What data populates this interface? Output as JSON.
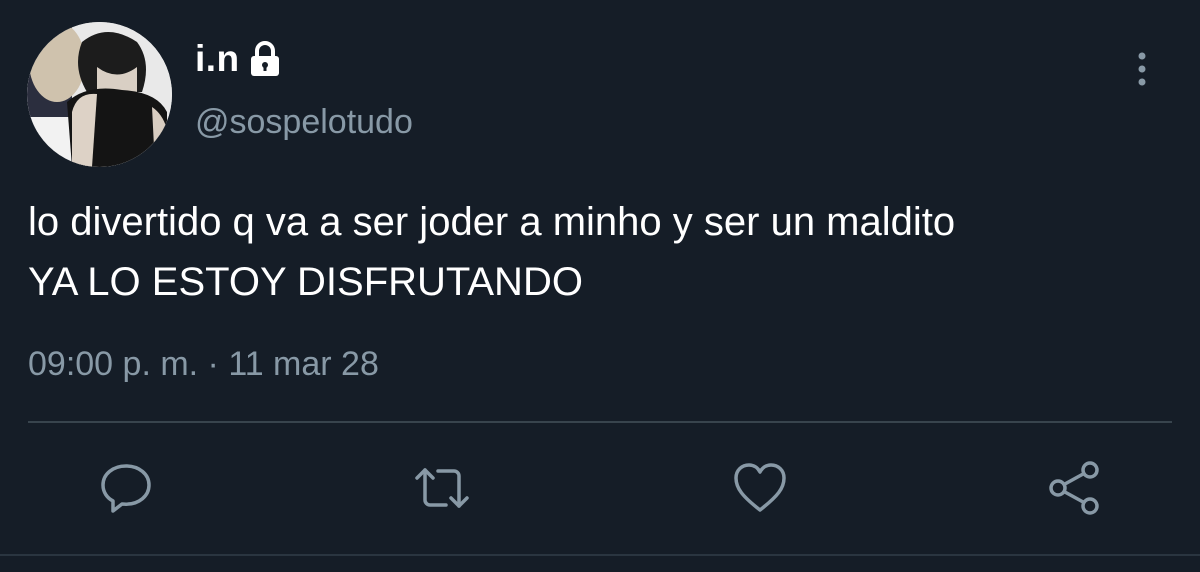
{
  "tweet": {
    "display_name": "i.n",
    "handle": "@sospelotudo",
    "text": "lo divertido q va a ser joder a minho y ser un maldito\nYA LO ESTOY DISFRUTANDO",
    "timestamp": "09:00 p. m. · 11 mar 28"
  },
  "icons": {
    "lock": "lock-icon",
    "more": "vertical-ellipsis-icon",
    "reply": "speech-bubble-icon",
    "retweet": "retweet-icon",
    "like": "heart-icon",
    "share": "share-icon"
  },
  "colors": {
    "background": "#151d27",
    "primary_text": "#ffffff",
    "secondary_text": "#8899a6",
    "divider": "#38444d"
  }
}
